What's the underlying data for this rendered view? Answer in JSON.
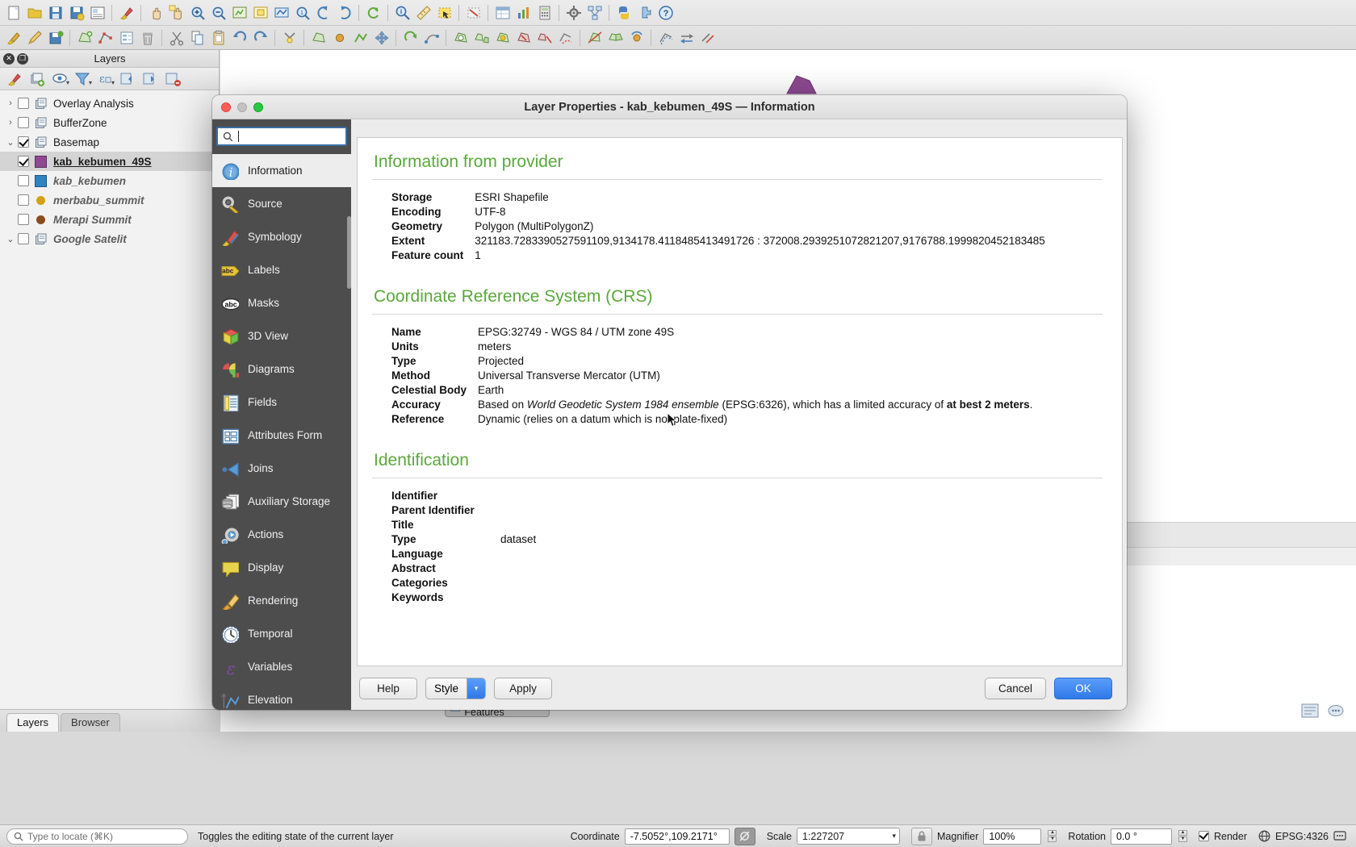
{
  "app": {
    "toolbar_row1": [
      {
        "name": "new-project-icon",
        "glyph": "doc"
      },
      {
        "name": "open-project-icon",
        "glyph": "folder"
      },
      {
        "name": "save-project-icon",
        "glyph": "save"
      },
      {
        "name": "save-project-as-icon",
        "glyph": "save-as"
      },
      {
        "name": "new-print-layout-icon",
        "glyph": "layout"
      },
      {
        "name": "style-manager-icon",
        "glyph": "brush"
      },
      {
        "name": "pan-map-icon",
        "glyph": "hand"
      },
      {
        "name": "pan-selection-icon",
        "glyph": "hand-sel"
      },
      {
        "name": "zoom-in-icon",
        "glyph": "zoom-in"
      },
      {
        "name": "zoom-out-icon",
        "glyph": "zoom-out"
      },
      {
        "name": "zoom-full-icon",
        "glyph": "zoom-full"
      },
      {
        "name": "zoom-selection-icon",
        "glyph": "zoom-sel"
      },
      {
        "name": "zoom-layer-icon",
        "glyph": "zoom-layer"
      },
      {
        "name": "zoom-native-icon",
        "glyph": "zoom-native"
      },
      {
        "name": "zoom-last-icon",
        "glyph": "zoom-last"
      },
      {
        "name": "zoom-next-icon",
        "glyph": "zoom-next"
      },
      {
        "name": "refresh-icon",
        "glyph": "refresh"
      },
      {
        "name": "identify-features-icon",
        "glyph": "identify"
      },
      {
        "name": "measure-line-icon",
        "glyph": "measure"
      },
      {
        "name": "select-features-icon",
        "glyph": "select"
      },
      {
        "name": "deselect-icon",
        "glyph": "deselect"
      },
      {
        "name": "open-attribute-table-icon",
        "glyph": "table"
      },
      {
        "name": "statistical-summary-icon",
        "glyph": "stats"
      },
      {
        "name": "field-calculator-icon",
        "glyph": "calc"
      },
      {
        "name": "processing-toolbox-icon",
        "glyph": "gear"
      },
      {
        "name": "model-designer-icon",
        "glyph": "model"
      },
      {
        "name": "python-console-icon",
        "glyph": "python"
      },
      {
        "name": "plugin-manager-icon",
        "glyph": "plugin"
      },
      {
        "name": "help-icon",
        "glyph": "help"
      }
    ],
    "toolbar_row2": [
      {
        "name": "current-edits-icon",
        "glyph": "edits"
      },
      {
        "name": "toggle-editing-icon",
        "glyph": "pencil"
      },
      {
        "name": "save-layer-edits-icon",
        "glyph": "save-edits"
      },
      {
        "name": "add-feature-icon",
        "glyph": "add-poly"
      },
      {
        "name": "vertex-tool-icon",
        "glyph": "vertex"
      },
      {
        "name": "modify-attributes-icon",
        "glyph": "attrib"
      },
      {
        "name": "delete-selected-icon",
        "glyph": "trash"
      },
      {
        "name": "cut-features-icon",
        "glyph": "cut"
      },
      {
        "name": "copy-features-icon",
        "glyph": "copy"
      },
      {
        "name": "paste-features-icon",
        "glyph": "paste"
      },
      {
        "name": "undo-icon",
        "glyph": "undo"
      },
      {
        "name": "redo-icon",
        "glyph": "redo"
      },
      {
        "name": "snapping-icon",
        "glyph": "snap"
      },
      {
        "name": "add-polygon-icon",
        "glyph": "polygon"
      },
      {
        "name": "add-point-icon",
        "glyph": "point"
      },
      {
        "name": "add-line-icon",
        "glyph": "line"
      },
      {
        "name": "move-feature-icon",
        "glyph": "move"
      },
      {
        "name": "rotate-feature-icon",
        "glyph": "rotate"
      },
      {
        "name": "simplify-icon",
        "glyph": "simplify"
      },
      {
        "name": "add-ring-icon",
        "glyph": "ring"
      },
      {
        "name": "add-part-icon",
        "glyph": "part"
      },
      {
        "name": "fill-ring-icon",
        "glyph": "fill-ring"
      },
      {
        "name": "delete-ring-icon",
        "glyph": "del-ring"
      },
      {
        "name": "delete-part-icon",
        "glyph": "del-part"
      },
      {
        "name": "reshape-icon",
        "glyph": "reshape"
      },
      {
        "name": "split-features-icon",
        "glyph": "split"
      },
      {
        "name": "merge-features-icon",
        "glyph": "merge"
      },
      {
        "name": "rotate-symbols-icon",
        "glyph": "rot-sym"
      },
      {
        "name": "offset-curve-icon",
        "glyph": "offset"
      },
      {
        "name": "reverse-line-icon",
        "glyph": "reverse"
      },
      {
        "name": "trim-extend-icon",
        "glyph": "trim"
      }
    ]
  },
  "layers_panel": {
    "title": "Layers",
    "toolbar": [
      {
        "name": "open-layer-styling-panel-icon",
        "glyph": "brush"
      },
      {
        "name": "add-group-icon",
        "glyph": "addgroup"
      },
      {
        "name": "manage-map-themes-icon",
        "glyph": "eye"
      },
      {
        "name": "filter-legend-icon",
        "glyph": "filter"
      },
      {
        "name": "expression-filter-icon",
        "glyph": "expr"
      },
      {
        "name": "expand-all-icon",
        "glyph": "expand"
      },
      {
        "name": "collapse-all-icon",
        "glyph": "collapse"
      },
      {
        "name": "remove-layer-icon",
        "glyph": "remove"
      }
    ],
    "tree": [
      {
        "label": "Overlay Analysis",
        "type": "group",
        "twisty": "collapsed",
        "checked": false,
        "style": "normal"
      },
      {
        "label": "BufferZone",
        "type": "group",
        "twisty": "collapsed",
        "checked": false,
        "style": "normal"
      },
      {
        "label": "Basemap",
        "type": "group",
        "twisty": "expanded",
        "checked": true,
        "style": "normal"
      },
      {
        "label": "kab_kebumen_49S",
        "type": "layer",
        "symbol": "polygon",
        "color": "#8e4a90",
        "checked": true,
        "style": "bold-underline",
        "selected": true
      },
      {
        "label": "kab_kebumen",
        "type": "layer",
        "symbol": "polygon",
        "color": "#2f82c0",
        "checked": false,
        "style": "italic"
      },
      {
        "label": "merbabu_summit",
        "type": "layer",
        "symbol": "point",
        "color": "#d4a017",
        "checked": false,
        "style": "italic"
      },
      {
        "label": "Merapi Summit",
        "type": "layer",
        "symbol": "point",
        "color": "#8a4b1e",
        "checked": false,
        "style": "italic"
      },
      {
        "label": "Google Satelit",
        "type": "group",
        "twisty": "expanded",
        "checked": false,
        "style": "italic"
      }
    ],
    "tabs": [
      {
        "label": "Layers",
        "active": true
      },
      {
        "label": "Browser",
        "active": false
      }
    ]
  },
  "canvas": {
    "show_all_features_label": "Show All Features",
    "bottom_icons": [
      {
        "name": "messages-log-icon"
      },
      {
        "name": "locator-settings-icon"
      }
    ]
  },
  "statusbar": {
    "locator_placeholder": "Type to locate (⌘K)",
    "message": "Toggles the editing state of the current layer",
    "coordinate_label": "Coordinate",
    "coordinate_value": "-7.5052°,109.2171°",
    "scale_label": "Scale",
    "scale_value": "1:227207",
    "magnifier_label": "Magnifier",
    "magnifier_value": "100%",
    "rotation_label": "Rotation",
    "rotation_value": "0.0 °",
    "render_label": "Render",
    "render_checked": true,
    "crs_label": "EPSG:4326"
  },
  "dialog": {
    "title": "Layer Properties - kab_kebumen_49S — Information",
    "search_placeholder": "",
    "search_value": "",
    "sidebar": [
      {
        "label": "Information",
        "icon": "information-icon",
        "active": true
      },
      {
        "label": "Source",
        "icon": "source-icon",
        "active": false
      },
      {
        "label": "Symbology",
        "icon": "symbology-icon",
        "active": false
      },
      {
        "label": "Labels",
        "icon": "labels-icon",
        "active": false
      },
      {
        "label": "Masks",
        "icon": "masks-icon",
        "active": false
      },
      {
        "label": "3D View",
        "icon": "3d-view-icon",
        "active": false
      },
      {
        "label": "Diagrams",
        "icon": "diagrams-icon",
        "active": false
      },
      {
        "label": "Fields",
        "icon": "fields-icon",
        "active": false
      },
      {
        "label": "Attributes Form",
        "icon": "attributes-form-icon",
        "active": false
      },
      {
        "label": "Joins",
        "icon": "joins-icon",
        "active": false
      },
      {
        "label": "Auxiliary Storage",
        "icon": "auxiliary-storage-icon",
        "active": false
      },
      {
        "label": "Actions",
        "icon": "actions-icon",
        "active": false
      },
      {
        "label": "Display",
        "icon": "display-icon",
        "active": false
      },
      {
        "label": "Rendering",
        "icon": "rendering-icon",
        "active": false
      },
      {
        "label": "Temporal",
        "icon": "temporal-icon",
        "active": false
      },
      {
        "label": "Variables",
        "icon": "variables-icon",
        "active": false
      },
      {
        "label": "Elevation",
        "icon": "elevation-icon",
        "active": false
      }
    ],
    "sections": {
      "provider": {
        "heading": "Information from provider",
        "rows": [
          {
            "key": "Storage",
            "value": "ESRI Shapefile"
          },
          {
            "key": "Encoding",
            "value": "UTF-8"
          },
          {
            "key": "Geometry",
            "value": "Polygon (MultiPolygonZ)"
          },
          {
            "key": "Extent",
            "value": "321183.7283390527591109,9134178.4118485413491726 : 372008.2939251072821207,9176788.1999820452183485"
          },
          {
            "key": "Feature count",
            "value": "1"
          }
        ]
      },
      "crs": {
        "heading": "Coordinate Reference System (CRS)",
        "rows": [
          {
            "key": "Name",
            "value": "EPSG:32749 - WGS 84 / UTM zone 49S"
          },
          {
            "key": "Units",
            "value": "meters"
          },
          {
            "key": "Type",
            "value": "Projected"
          },
          {
            "key": "Method",
            "value": "Universal Transverse Mercator (UTM)"
          },
          {
            "key": "Celestial Body",
            "value": "Earth"
          }
        ],
        "accuracy": {
          "key": "Accuracy",
          "part1": "Based on ",
          "italic": "World Geodetic System 1984 ensemble",
          "part2": " (EPSG:6326), which has a limited accuracy of ",
          "bold": "at best 2 meters",
          "part3": "."
        },
        "reference": {
          "key": "Reference",
          "value": "Dynamic (relies on a datum which is not plate-fixed)"
        }
      },
      "identification": {
        "heading": "Identification",
        "rows": [
          {
            "key": "Identifier",
            "value": ""
          },
          {
            "key": "Parent Identifier",
            "value": ""
          },
          {
            "key": "Title",
            "value": ""
          },
          {
            "key": "Type",
            "value": "dataset"
          },
          {
            "key": "Language",
            "value": ""
          },
          {
            "key": "Abstract",
            "value": ""
          },
          {
            "key": "Categories",
            "value": ""
          },
          {
            "key": "Keywords",
            "value": ""
          }
        ]
      }
    },
    "footer": {
      "help_label": "Help",
      "style_label": "Style",
      "apply_label": "Apply",
      "cancel_label": "Cancel",
      "ok_label": "OK"
    }
  },
  "colors": {
    "accent_green": "#5aa83c",
    "primary_blue": "#2f7ae8",
    "sidebar_dark": "#4d4d4d"
  }
}
